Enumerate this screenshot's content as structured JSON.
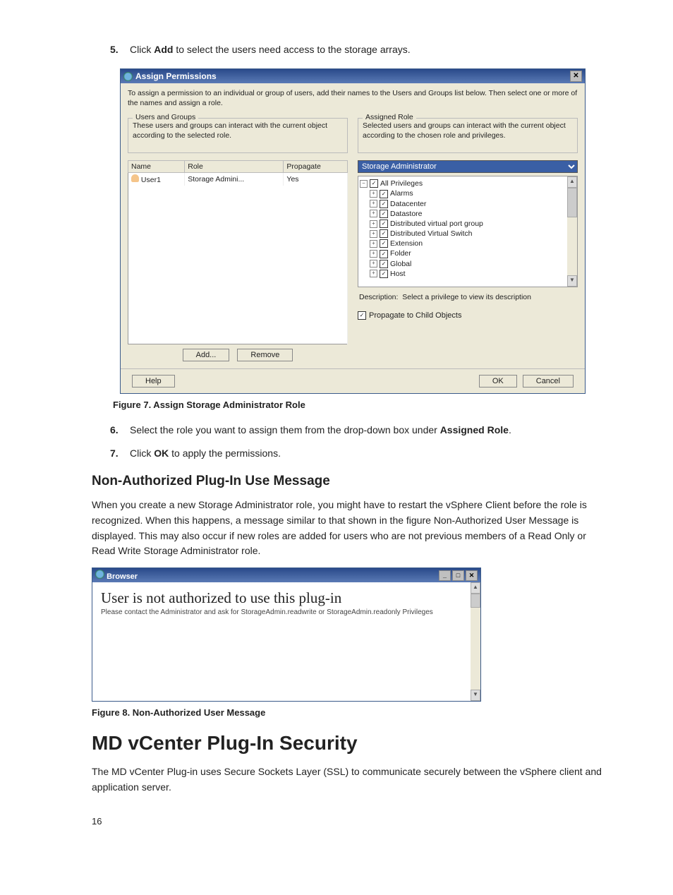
{
  "step5": {
    "num": "5.",
    "pre": "Click ",
    "bold": "Add",
    "post": " to select the users need access to the storage arrays."
  },
  "step6": {
    "num": "6.",
    "pre": "Select the role you want to assign them from the drop-down box under ",
    "bold": "Assigned Role",
    "post": "."
  },
  "step7": {
    "num": "7.",
    "pre": "Click ",
    "bold": "OK",
    "post": " to apply the permissions."
  },
  "dialog1": {
    "title": "Assign Permissions",
    "intro": "To assign a permission to an individual or group of users, add their names to the Users and Groups list below. Then select one or more of the names and assign a role.",
    "users_groups_legend": "Users and Groups",
    "users_groups_desc": "These users and groups can interact with the current object according to the selected role.",
    "cols": {
      "name": "Name",
      "role": "Role",
      "propagate": "Propagate"
    },
    "row": {
      "name": "User1",
      "role": "Storage Admini...",
      "propagate": "Yes"
    },
    "add_btn": "Add...",
    "remove_btn": "Remove",
    "assigned_legend": "Assigned Role",
    "assigned_desc": "Selected users and groups can interact with the current object according to the chosen role and privileges.",
    "selected_role": "Storage Administrator",
    "privs": [
      "All Privileges",
      "Alarms",
      "Datacenter",
      "Datastore",
      "Distributed virtual port group",
      "Distributed Virtual Switch",
      "Extension",
      "Folder",
      "Global",
      "Host"
    ],
    "desc_label": "Description:",
    "desc_text": "Select a privilege to view its description",
    "propagate_label": "Propagate to Child Objects",
    "help_btn": "Help",
    "ok_btn": "OK",
    "cancel_btn": "Cancel"
  },
  "fig7": "Figure 7. Assign Storage Administrator Role",
  "sec_h2": "Non-Authorized Plug-In Use Message",
  "sec_para": "When you create a new Storage Administrator role, you might have to restart the vSphere Client before the role is recognized. When this happens, a message similar to that shown in the figure Non-Authorized User Message is displayed. This may also occur if new roles are added for users who are not previous members of a Read Only or Read Write Storage Administrator role.",
  "dialog2": {
    "title": "Browser",
    "big": "User is not authorized to use this plug-in",
    "small": "Please contact the Administrator and ask for StorageAdmin.readwrite or StorageAdmin.readonly Privileges"
  },
  "fig8": "Figure 8. Non-Authorized User Message",
  "sec_h1": "MD vCenter Plug-In Security",
  "sec_para2": "The MD vCenter Plug-in uses Secure Sockets Layer (SSL) to communicate securely between the vSphere client and application server.",
  "pagenum": "16"
}
